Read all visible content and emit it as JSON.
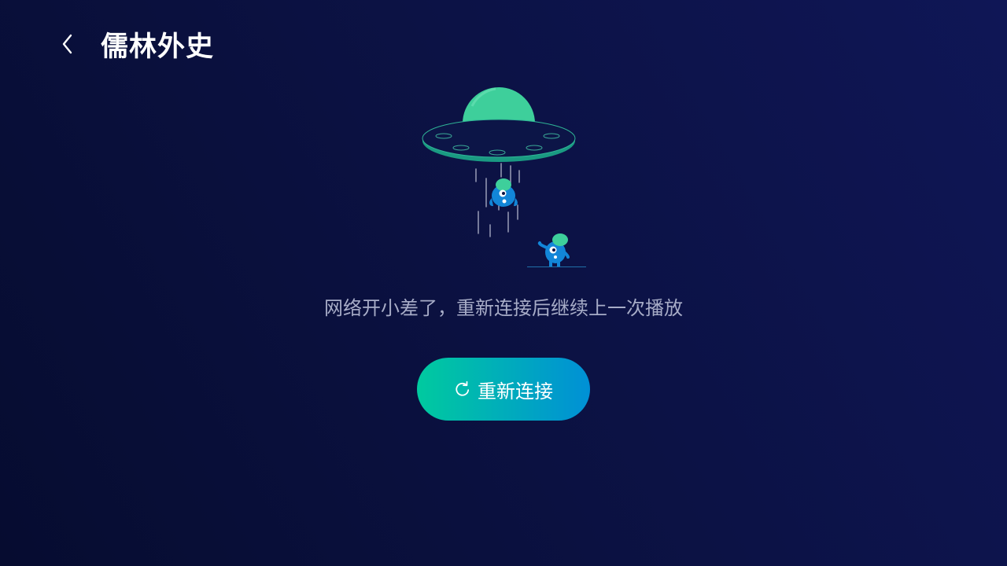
{
  "header": {
    "back_icon": "chevron-left-icon",
    "title": "儒林外史"
  },
  "illustration": {
    "subject": "ufo-abducting-alien",
    "accent_color": "#3ecf9b",
    "creature_color": "#1286d8"
  },
  "error": {
    "message": "网络开小差了，重新连接后继续上一次播放"
  },
  "reconnect_button": {
    "icon": "refresh-icon",
    "label": "重新连接",
    "gradient_start": "#00ca9f",
    "gradient_end": "#0090d6"
  },
  "theme": {
    "background": "#0b1141",
    "text_primary": "#ffffff",
    "text_secondary": "#a7acc7"
  }
}
